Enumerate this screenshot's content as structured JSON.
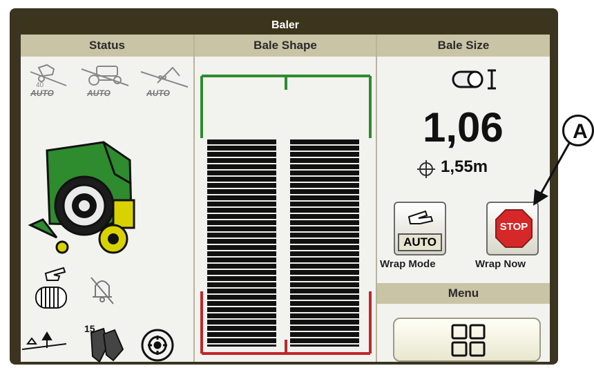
{
  "window": {
    "title": "Baler"
  },
  "columns": {
    "status": "Status",
    "bale_shape": "Bale Shape",
    "bale_size": "Bale Size"
  },
  "status_panel": {
    "auto_labels": [
      "AUTO",
      "AUTO",
      "AUTO"
    ]
  },
  "bale_size": {
    "value": "1,06",
    "diameter": "1,55m"
  },
  "wrap": {
    "auto_label": "AUTO",
    "stop_label": "STOP",
    "wrap_mode_label": "Wrap Mode",
    "wrap_now_label": "Wrap Now"
  },
  "menu": {
    "header": "Menu"
  },
  "annotation": {
    "callout": "A"
  },
  "icons": {
    "bale_size": "cylinder-bale-icon",
    "diameter": "diameter-icon",
    "baler": "baler-machine-icon",
    "bale_count": "bale-counter-icon",
    "alarm_off": "bell-muted-icon",
    "pickup": "pickup-raise-icon",
    "knife": "knife-count-icon",
    "net": "net-roll-icon",
    "menu": "grid-menu-icon"
  },
  "colors": {
    "header_bg": "#c9c4a5",
    "bale_frame_top": "#2e8b2e",
    "bale_frame_bottom": "#c0262b",
    "baler_green": "#2e8b2e",
    "stop_red": "#d62828"
  }
}
